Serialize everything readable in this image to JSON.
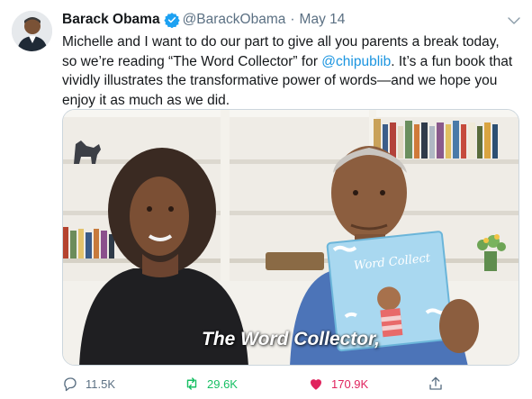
{
  "tweet": {
    "author_name": "Barack Obama",
    "handle": "@BarackObama",
    "separator": "·",
    "date": "May 14",
    "text_before_title": "Michelle and I want to do our part to give all you parents a break today, so we’re reading “The Word Collector” for ",
    "mention": "@chipublib",
    "text_after_mention": ". It’s a fun book that vividly illustrates the transformative power of words—and we hope you enjoy it as much as we did.",
    "media_caption": "The Word Collector,",
    "book_title": "Word Collector"
  },
  "actions": {
    "reply_count": "11.5K",
    "retweet_count": "29.6K",
    "like_count": "170.9K"
  },
  "colors": {
    "link": "#1b95e0",
    "retweet_active": "#17bf63",
    "like_active": "#e0245e",
    "verified": "#1da1f2",
    "muted": "#5b7083"
  }
}
